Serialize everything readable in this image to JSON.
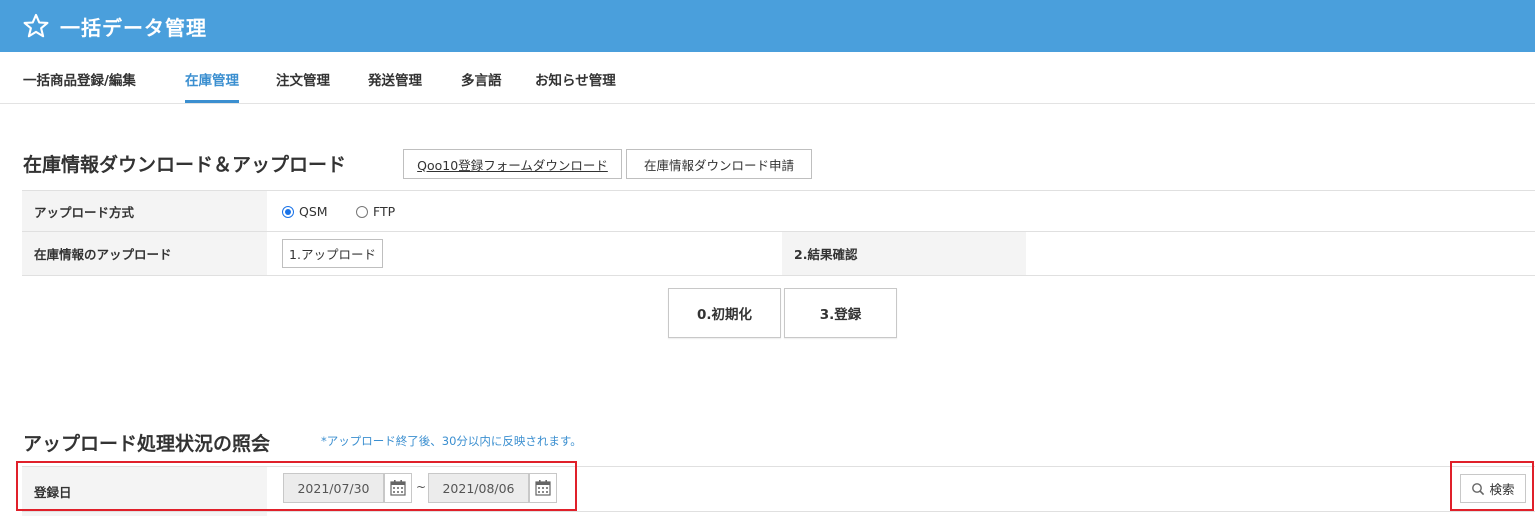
{
  "header": {
    "title": "一括データ管理",
    "icon": "star-icon",
    "bg_color": "#4a9fdc"
  },
  "tabs": [
    {
      "label": "一括商品登録/編集",
      "active": false
    },
    {
      "label": "在庫管理",
      "active": true
    },
    {
      "label": "注文管理",
      "active": false
    },
    {
      "label": "発送管理",
      "active": false
    },
    {
      "label": "多言語",
      "active": false
    },
    {
      "label": "お知らせ管理",
      "active": false
    }
  ],
  "inventory": {
    "title": "在庫情報ダウンロード＆アップロード",
    "form_download_btn": "Qoo10登録フォームダウンロード",
    "request_btn": "在庫情報ダウンロード申請",
    "upload_method_label": "アップロード方式",
    "upload_methods": [
      {
        "label": "QSM",
        "checked": true
      },
      {
        "label": "FTP",
        "checked": false
      }
    ],
    "upload_label": "在庫情報のアップロード",
    "upload_btn": "1.アップロード",
    "result_label": "2.結果確認",
    "reset_btn": "0.初期化",
    "register_btn": "3.登録"
  },
  "status": {
    "title": "アップロード処理状況の照会",
    "note": "*アップロード終了後、30分以内に反映されます。",
    "date_label": "登録日",
    "date_from": "2021/07/30",
    "date_separator": "~",
    "date_to": "2021/08/06",
    "search_btn": "検索",
    "highlight_color": "#e0202a"
  }
}
